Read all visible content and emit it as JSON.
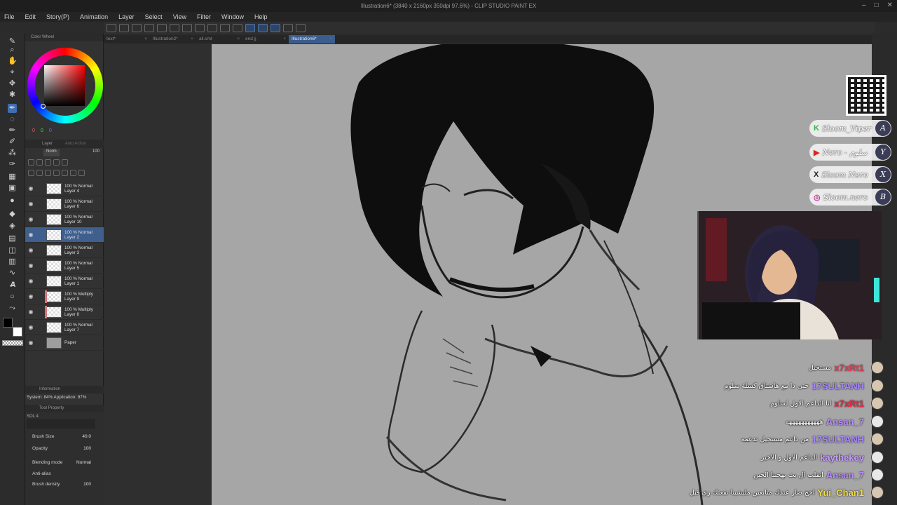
{
  "window": {
    "title": "Illustration6* (3840 x 2160px 350dpi 97.6%) - CLIP STUDIO PAINT EX",
    "controls": [
      "–",
      "□",
      "✕"
    ]
  },
  "menu": [
    "File",
    "Edit",
    "Story(P)",
    "Animation",
    "Layer",
    "Select",
    "View",
    "Filter",
    "Window",
    "Help"
  ],
  "tabs": [
    "text*",
    "Illustration2*",
    "all.cmt",
    "end jj",
    "Illustration6*"
  ],
  "color_panel": {
    "title": "Color Wheel",
    "rgb": [
      "0",
      "0",
      "0"
    ]
  },
  "layer_panel": {
    "title": "Layer",
    "autoaction": "Auto Action",
    "opacity": "100",
    "blend": "Norm",
    "layers": [
      {
        "mode": "100 % Normal",
        "name": "Layer 4"
      },
      {
        "mode": "100 % Normal",
        "name": "Layer 6"
      },
      {
        "mode": "100 % Normal",
        "name": "Layer 10"
      },
      {
        "mode": "100 % Normal",
        "name": "Layer 2"
      },
      {
        "mode": "100 % Normal",
        "name": "Layer 3"
      },
      {
        "mode": "100 % Normal",
        "name": "Layer 5"
      },
      {
        "mode": "100 % Normal",
        "name": "Layer 1"
      },
      {
        "mode": "100 % Multiply",
        "name": "Layer 9"
      },
      {
        "mode": "100 % Multiply",
        "name": "Layer 8"
      },
      {
        "mode": "100 % Normal",
        "name": "Layer 7"
      },
      {
        "mode": "",
        "name": "Paper"
      }
    ]
  },
  "info": {
    "title": "Information",
    "system": "System: 84%  Application: 97%"
  },
  "tool_property": {
    "title": "Tool Property",
    "brush": "SOL 4",
    "brush_size_label": "Brush Size",
    "brush_size": "40.0",
    "opacity_label": "Opacity",
    "opacity": "100",
    "blend_label": "Blending mode",
    "blend": "Normal",
    "aa_label": "Anti-alias",
    "density_label": "Brush density",
    "density": "100"
  },
  "socials": [
    {
      "icon": "K",
      "color": "#2fb34a",
      "handle": "Sloom_Viper",
      "end": "A"
    },
    {
      "icon": "▶",
      "color": "#e02424",
      "handle": "Nero - سلوم",
      "end": "Y"
    },
    {
      "icon": "X",
      "color": "#222222",
      "handle": "Sloom Nero",
      "end": "X"
    },
    {
      "icon": "◎",
      "color": "#c23aa0",
      "handle": "Sloom.nero",
      "end": "B"
    }
  ],
  "chat": [
    {
      "user": "x7xRt1",
      "color": "#e0304a",
      "msg": "مستحيل",
      "avatar": "photo"
    },
    {
      "user": "17SULTANH",
      "color": "#a889ff",
      "msg": "حتى دا مع هاشتاق كسلة سلوم",
      "avatar": "photo"
    },
    {
      "user": "x7xRt1",
      "color": "#e0304a",
      "msg": "انا الداعم الاول لسلوم",
      "avatar": "photo"
    },
    {
      "user": "Ansan_7",
      "color": "#b98cff",
      "msg": "هههههههههههه",
      "avatar": "generic"
    },
    {
      "user": "17SULTANH",
      "color": "#a889ff",
      "msg": "من داعم مستحيل تدعمه",
      "avatar": "photo"
    },
    {
      "user": "kaythekey",
      "color": "#c69cff",
      "msg": "الداعم الاول و الاخير",
      "avatar": "generic"
    },
    {
      "user": "Ansan_7",
      "color": "#b98cff",
      "msg": "انقلب ال بث بهجننا الحين",
      "avatar": "generic"
    },
    {
      "user": "Yui_Chan1",
      "color": "#f5df3a",
      "msg": "اخخ صار عندك متابعين مليشينا تفعتك زي قبل",
      "avatar": "photo"
    }
  ]
}
